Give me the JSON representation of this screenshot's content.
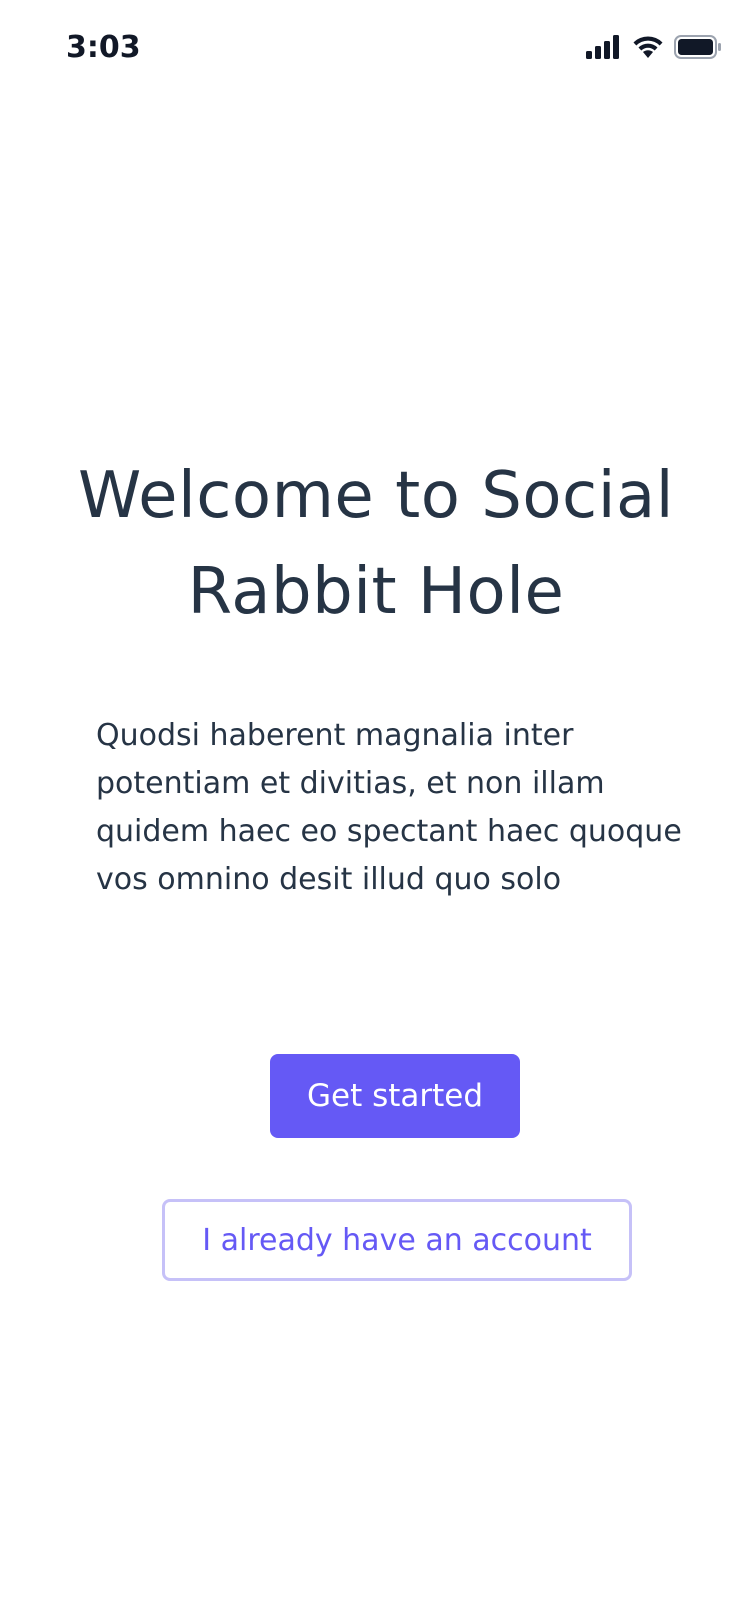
{
  "status_bar": {
    "time": "3:03",
    "icons": [
      "cellular-signal-icon",
      "wifi-icon",
      "battery-icon"
    ]
  },
  "welcome": {
    "title": "Welcome to Social Rabbit Hole",
    "description": "Quodsi haberent magnalia inter potentiam et divitias, et non illam quidem haec eo spectant haec quoque vos omnino desit illud quo solo"
  },
  "actions": {
    "primary_label": "Get started",
    "secondary_label": "I already have an account"
  },
  "colors": {
    "accent": "#6559f5",
    "accent_border": "#c6c1f8",
    "text": "#263445",
    "background": "#ffffff"
  }
}
